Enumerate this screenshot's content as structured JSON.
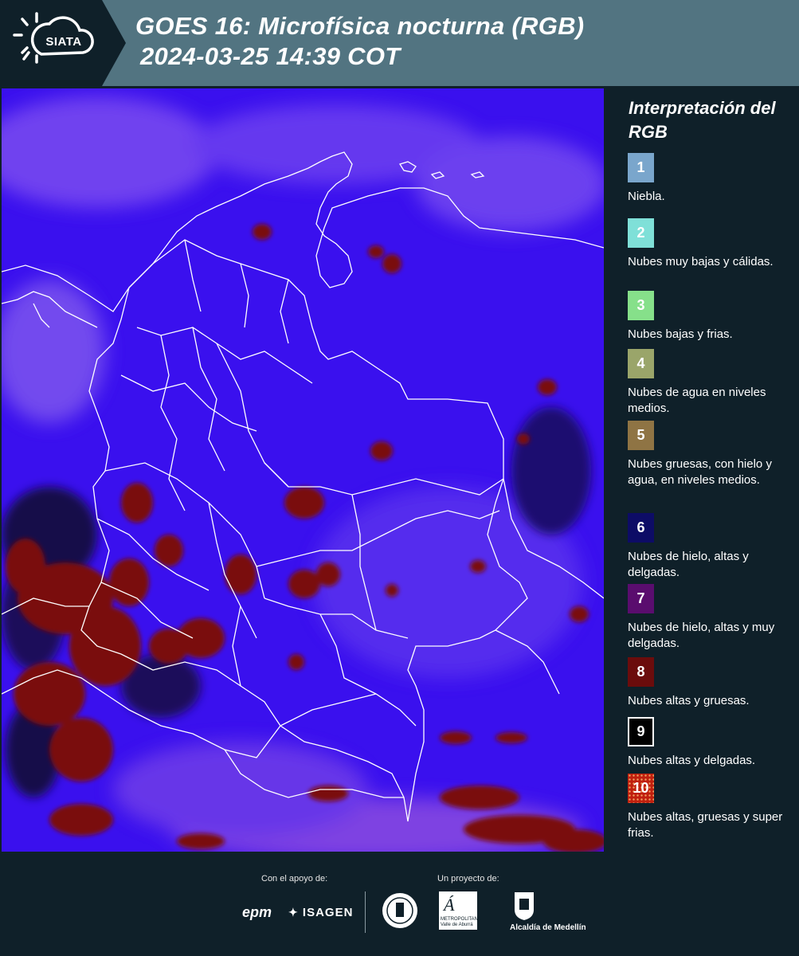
{
  "header": {
    "logo_text": "SIATA",
    "title_line1": "GOES 16: Microfísica nocturna (RGB)",
    "title_line2": "2024-03-25 14:39 COT"
  },
  "legend": {
    "title": "Interpretación del RGB",
    "items": [
      {
        "number": "1",
        "label": "Niebla.",
        "color": "#7aa6cc"
      },
      {
        "number": "2",
        "label": "Nubes muy bajas y cálidas.",
        "color": "#7fe0d8"
      },
      {
        "number": "3",
        "label": "Nubes bajas y frias.",
        "color": "#86e08a"
      },
      {
        "number": "4",
        "label": "Nubes de agua en niveles medios.",
        "color": "#9aa56a"
      },
      {
        "number": "5",
        "label": "Nubes gruesas, con hielo y agua, en niveles medios.",
        "color": "#8f7444"
      },
      {
        "number": "6",
        "label": "Nubes de hielo, altas y delgadas.",
        "color": "#0d0c66"
      },
      {
        "number": "7",
        "label": "Nubes de hielo, altas y muy delgadas.",
        "color": "#5a0d6e"
      },
      {
        "number": "8",
        "label": "Nubes altas y gruesas.",
        "color": "#6b0c0c"
      },
      {
        "number": "9",
        "label": "Nubes altas y delgadas.",
        "color": "#000000"
      },
      {
        "number": "10",
        "label": "Nubes altas, gruesas y super frias.",
        "color": "#c0200f"
      }
    ]
  },
  "map": {
    "colors": {
      "background": "#3a10ee",
      "thin_ice": "#6a3ae8",
      "thick_cloud": "#7a0a10",
      "border": "#ffffff"
    }
  },
  "footer": {
    "support_label": "Con el apoyo de:",
    "project_label": "Un proyecto de:",
    "sponsors": [
      "epm",
      "ISAGEN"
    ],
    "partners": [
      "Área Metropolitana Valle de Aburrá",
      "Alcaldía de Medellín"
    ],
    "partner_caption_area": "METROPOLITANA",
    "partner_caption_area2": "Valle de Aburrá",
    "partner_caption_alcaldia": "Alcaldía de Medellín"
  }
}
